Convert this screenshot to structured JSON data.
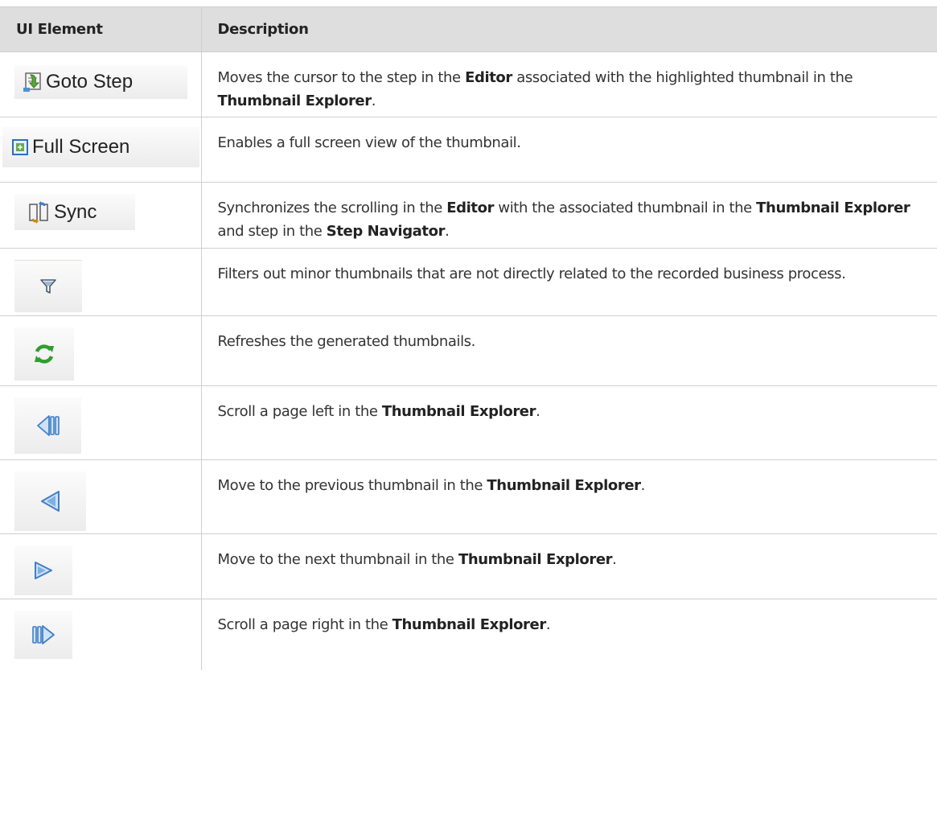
{
  "header": {
    "col1": "UI Element",
    "col2": "Description"
  },
  "rows": [
    {
      "element": {
        "type": "button",
        "label": "Goto Step",
        "icon": "goto-step-icon"
      },
      "desc": [
        {
          "t": "Moves the cursor to the step in the "
        },
        {
          "t": "Editor",
          "b": true
        },
        {
          "t": " associated with the highlighted thumbnail in the "
        },
        {
          "t": "Thumbnail Explorer",
          "b": true
        },
        {
          "t": "."
        }
      ]
    },
    {
      "element": {
        "type": "button",
        "label": "Full Screen",
        "icon": "full-screen-icon"
      },
      "desc": [
        {
          "t": "Enables a full screen view of the thumbnail."
        }
      ]
    },
    {
      "element": {
        "type": "button",
        "label": "Sync",
        "icon": "sync-icon"
      },
      "desc": [
        {
          "t": "Synchronizes the scrolling in the "
        },
        {
          "t": "Editor",
          "b": true
        },
        {
          "t": " with the associated thumbnail in the "
        },
        {
          "t": "Thumbnail Explorer",
          "b": true
        },
        {
          "t": " and step in the "
        },
        {
          "t": "Step Navigator",
          "b": true
        },
        {
          "t": "."
        }
      ]
    },
    {
      "element": {
        "type": "icon",
        "icon": "filter-icon"
      },
      "desc": [
        {
          "t": "Filters out minor thumbnails that are not directly related to the recorded business process."
        }
      ]
    },
    {
      "element": {
        "type": "icon",
        "icon": "refresh-icon"
      },
      "desc": [
        {
          "t": "Refreshes the generated thumbnails."
        }
      ]
    },
    {
      "element": {
        "type": "icon",
        "icon": "scroll-page-left-icon"
      },
      "desc": [
        {
          "t": "Scroll a page left in the "
        },
        {
          "t": "Thumbnail Explorer",
          "b": true
        },
        {
          "t": "."
        }
      ]
    },
    {
      "element": {
        "type": "icon",
        "icon": "previous-icon"
      },
      "desc": [
        {
          "t": "Move to the previous thumbnail in the "
        },
        {
          "t": "Thumbnail Explorer",
          "b": true
        },
        {
          "t": "."
        }
      ]
    },
    {
      "element": {
        "type": "icon",
        "icon": "next-icon"
      },
      "desc": [
        {
          "t": "Move to the next thumbnail in the "
        },
        {
          "t": "Thumbnail Explorer",
          "b": true
        },
        {
          "t": "."
        }
      ]
    },
    {
      "element": {
        "type": "icon",
        "icon": "scroll-page-right-icon"
      },
      "desc": [
        {
          "t": "Scroll a page right in the "
        },
        {
          "t": "Thumbnail Explorer",
          "b": true
        },
        {
          "t": "."
        }
      ]
    }
  ],
  "colors": {
    "header_bg": "#dedede",
    "border": "#cfcfcf",
    "icon_blue": "#4f8fd6",
    "refresh_green": "#2f9e2f"
  }
}
